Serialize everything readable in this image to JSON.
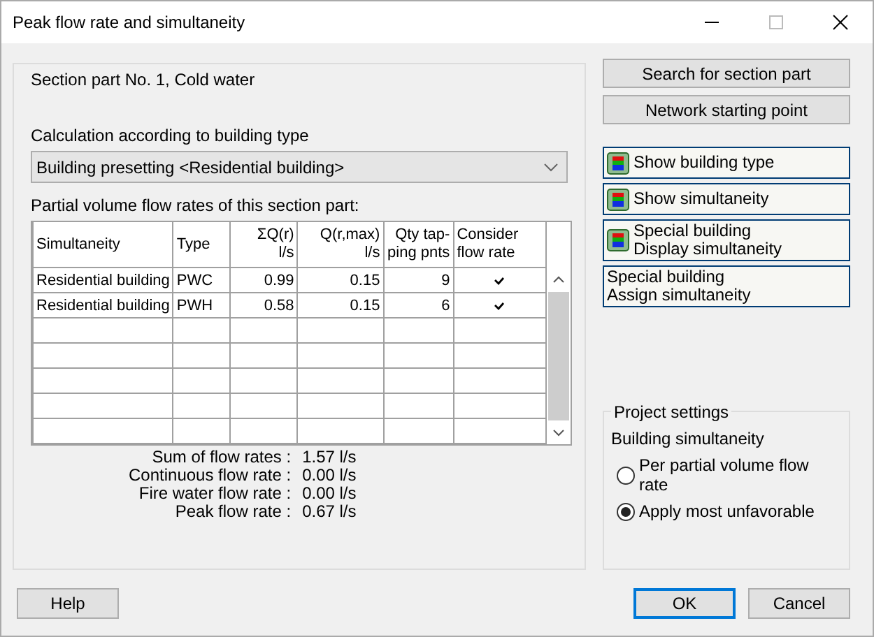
{
  "window": {
    "title": "Peak flow rate and simultaneity"
  },
  "section_title": "Section part No. 1, Cold water",
  "calculation": {
    "label": "Calculation according to building type",
    "value": "Building presetting <Residential building>"
  },
  "table": {
    "caption": "Partial volume flow rates of this section part:",
    "columns": [
      "Simultaneity",
      "Type",
      "ΣQ(r)\nl/s",
      "Q(r,max)\nl/s",
      "Qty tap-\nping pnts",
      "Consider\nflow rate"
    ],
    "rows": [
      {
        "simultaneity": "Residential building",
        "type": "PWC",
        "sum_q": "0.99",
        "q_max": "0.15",
        "qty": "9",
        "consider": true
      },
      {
        "simultaneity": "Residential building",
        "type": "PWH",
        "sum_q": "0.58",
        "q_max": "0.15",
        "qty": "6",
        "consider": true
      }
    ]
  },
  "totals": [
    {
      "label": "Sum of flow rates :",
      "value": "1.57 l/s"
    },
    {
      "label": "Continuous flow rate :",
      "value": "0.00 l/s"
    },
    {
      "label": "Fire water flow rate :",
      "value": "0.00 l/s"
    },
    {
      "label": "Peak flow rate :",
      "value": "0.67 l/s"
    }
  ],
  "top_buttons": [
    "Search for section part",
    "Network starting point"
  ],
  "action_buttons": [
    {
      "kind": "icon",
      "lines": [
        "Show building type"
      ]
    },
    {
      "kind": "icon",
      "lines": [
        "Show simultaneity"
      ]
    },
    {
      "kind": "icon",
      "lines": [
        "Special building",
        "Display simultaneity"
      ]
    },
    {
      "kind": "plain",
      "lines": [
        "Special building",
        "Assign simultaneity"
      ]
    }
  ],
  "project_settings": {
    "title": "Project settings",
    "label": "Building simultaneity",
    "options": [
      {
        "label": "Per partial volume flow rate",
        "selected": false
      },
      {
        "label": "Apply most unfavorable",
        "selected": true
      }
    ]
  },
  "footer": {
    "help": "Help",
    "ok": "OK",
    "cancel": "Cancel"
  }
}
